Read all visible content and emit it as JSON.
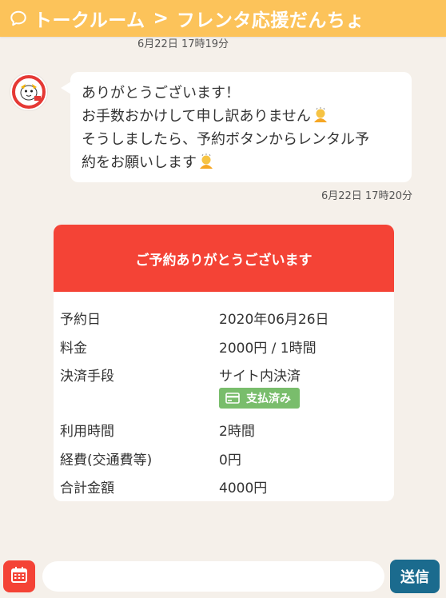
{
  "header": {
    "breadcrumb_root": "トークルーム",
    "separator": ">",
    "room_name": "フレンタ応援だんちょ",
    "bg_color": "#fcc35a"
  },
  "messages": [
    {
      "timestamp": "6月22日 17時19分"
    },
    {
      "avatar_icon": "mascot-avatar-icon",
      "lines": [
        "ありがとうございます！",
        "お手数おかけして申し訳ありません",
        "そうしましたら、予約ボタンからレンタル予",
        "約をお願いします"
      ],
      "emoji_icon": "bowing-person-icon",
      "timestamp": "6月22日 17時20分"
    }
  ],
  "reservation_card": {
    "title": "ご予約ありがとうございます",
    "header_color": "#f44336",
    "rows": [
      {
        "label": "予約日",
        "value": "2020年06月26日"
      },
      {
        "label": "料金",
        "value": "2000円 / 1時間"
      },
      {
        "label": "決済手段",
        "value": "サイト内決済"
      },
      {
        "label": "利用時間",
        "value": "2時間"
      },
      {
        "label": "経費(交通費等)",
        "value": "0円"
      },
      {
        "label": "合計金額",
        "value": "4000円"
      }
    ],
    "payment_badge": {
      "icon": "credit-card-icon",
      "label": "支払済み",
      "color": "#79bd6c"
    }
  },
  "composer": {
    "calendar_icon": "calendar-icon",
    "input_value": "",
    "send_label": "送信",
    "send_color": "#1b6b8e"
  }
}
